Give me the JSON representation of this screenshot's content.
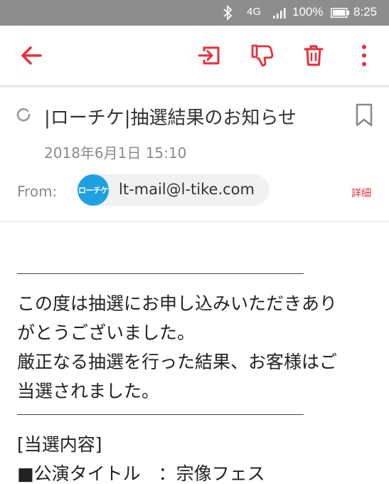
{
  "status_bar": {
    "network": "4G",
    "battery_percent": "100%",
    "time": "8:25",
    "icons": [
      "bluetooth-icon",
      "signal-icon",
      "battery-icon"
    ]
  },
  "toolbar": {
    "icons": [
      "back-arrow-icon",
      "move-to-inbox-icon",
      "thumbs-down-icon",
      "trash-icon",
      "more-vertical-icon"
    ],
    "accent_color": "#e5303a"
  },
  "email": {
    "subject": "|ローチケ|抽選結果のお知らせ",
    "date": "2018年6月1日 15:10",
    "from_label": "From:",
    "sender_avatar_text": "ローチケ",
    "sender_email": "lt-mail@l-tike.com",
    "details_label": "詳細",
    "body": {
      "line1": "この度は抽選にお申し込みいただきあり",
      "line2": "がとうございました。",
      "line3": "厳正なる抽選を行った結果、お客様はご",
      "line4": "当選されました。",
      "section_heading": "[当選内容]",
      "performance_line": "■公演タイトル　：宗像フェス"
    }
  },
  "colors": {
    "status_bar_bg": "#8d8d8d",
    "avatar_bg": "#1fa0e0",
    "accent": "#e5303a"
  }
}
